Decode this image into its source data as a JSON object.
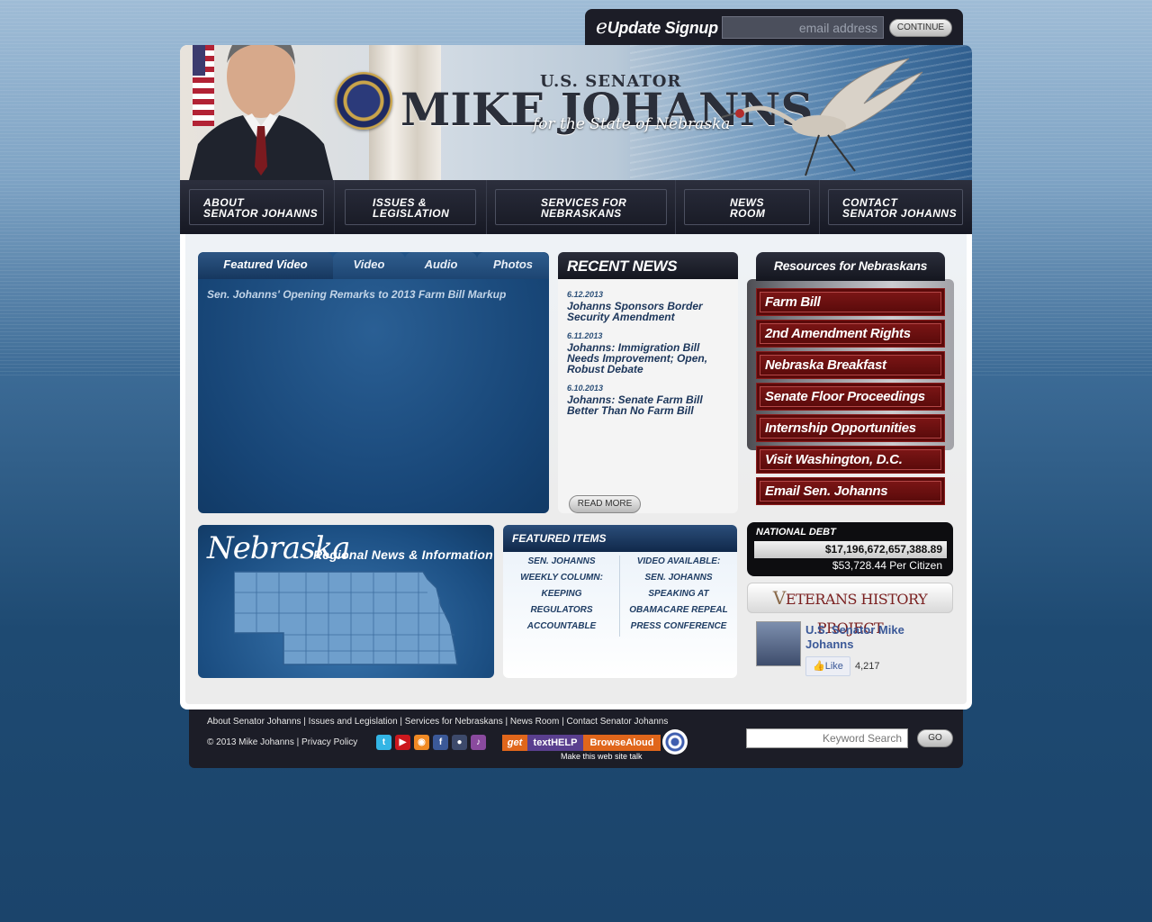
{
  "eupdate": {
    "title_e": "e",
    "title_rest": "Update Signup",
    "email_placeholder": "email address",
    "continue_label": "CONTINUE"
  },
  "header": {
    "title_small": "U.S. SENATOR",
    "name": "MIKE JOHANNS",
    "state": "for the State of Nebraska"
  },
  "nav": {
    "items": [
      {
        "label": "ABOUT\nSENATOR JOHANNS"
      },
      {
        "label": "ISSUES &\nLEGISLATION"
      },
      {
        "label": "SERVICES FOR\nNEBRASKANS"
      },
      {
        "label": "NEWS\nROOM"
      },
      {
        "label": "CONTACT\nSENATOR JOHANNS"
      }
    ]
  },
  "media": {
    "tabs": [
      {
        "label": "Featured Video"
      },
      {
        "label": "Video"
      },
      {
        "label": "Audio"
      },
      {
        "label": "Photos"
      }
    ],
    "video_title": "Sen. Johanns' Opening Remarks to 2013 Farm Bill Markup"
  },
  "news": {
    "header": "RECENT NEWS",
    "items": [
      {
        "date": "6.12.2013",
        "title": "Johanns Sponsors Border Security Amendment"
      },
      {
        "date": "6.11.2013",
        "title": "Johanns: Immigration Bill Needs Improvement; Open, Robust Debate"
      },
      {
        "date": "6.10.2013",
        "title": "Johanns: Senate Farm Bill Better Than No Farm Bill"
      }
    ],
    "read_more": "READ MORE"
  },
  "resources": {
    "header": "Resources for Nebraskans",
    "items": [
      {
        "label": "Farm Bill"
      },
      {
        "label": "2nd Amendment Rights"
      },
      {
        "label": "Nebraska Breakfast"
      },
      {
        "label": "Senate Floor Proceedings"
      },
      {
        "label": "Internship Opportunities"
      },
      {
        "label": "Visit Washington, D.C."
      },
      {
        "label": "Email Sen. Johanns"
      }
    ]
  },
  "nebraska": {
    "title": "Nebraska",
    "subtitle": "Regional News & Information"
  },
  "featured": {
    "header": "FEATURED ITEMS",
    "left": "SEN. JOHANNS\nWEEKLY COLUMN:\nKEEPING\nREGULATORS\nACCOUNTABLE",
    "right": "VIDEO AVAILABLE:\nSEN. JOHANNS\nSPEAKING AT\nOBAMACARE REPEAL\nPRESS CONFERENCE"
  },
  "debt": {
    "label": "NATIONAL DEBT",
    "value": "$17,196,672,657,388.89",
    "per_citizen": "$53,728.44 Per Citizen"
  },
  "veterans": {
    "v": "V",
    "label": "ETERANS HISTORY PROJECT"
  },
  "facebook": {
    "name": "U.S. Senator Mike Johanns",
    "like": "Like",
    "count": "4,217"
  },
  "footer": {
    "links": "About Senator Johanns | Issues and Legislation | Services for Nebraskans | News Room | Contact Senator Johanns",
    "copyright": "© 2013 Mike Johanns | Privacy Policy",
    "social_icons": [
      "twitter-icon",
      "youtube-icon",
      "rss-icon",
      "facebook-icon",
      "flickr-icon",
      "podcast-icon"
    ],
    "browsealoud_get": "get",
    "browsealoud_text": "textHELP",
    "browsealoud_browse": "BrowseAloud",
    "browsealoud_tag": "Make this web site talk",
    "search_placeholder": "Keyword Search",
    "go_label": "GO"
  },
  "colors": {
    "nav_bg": "#1a1c27",
    "resource_red": "#6b0f0f",
    "news_blue": "#1b355a",
    "body_blue": "#1b446b"
  }
}
